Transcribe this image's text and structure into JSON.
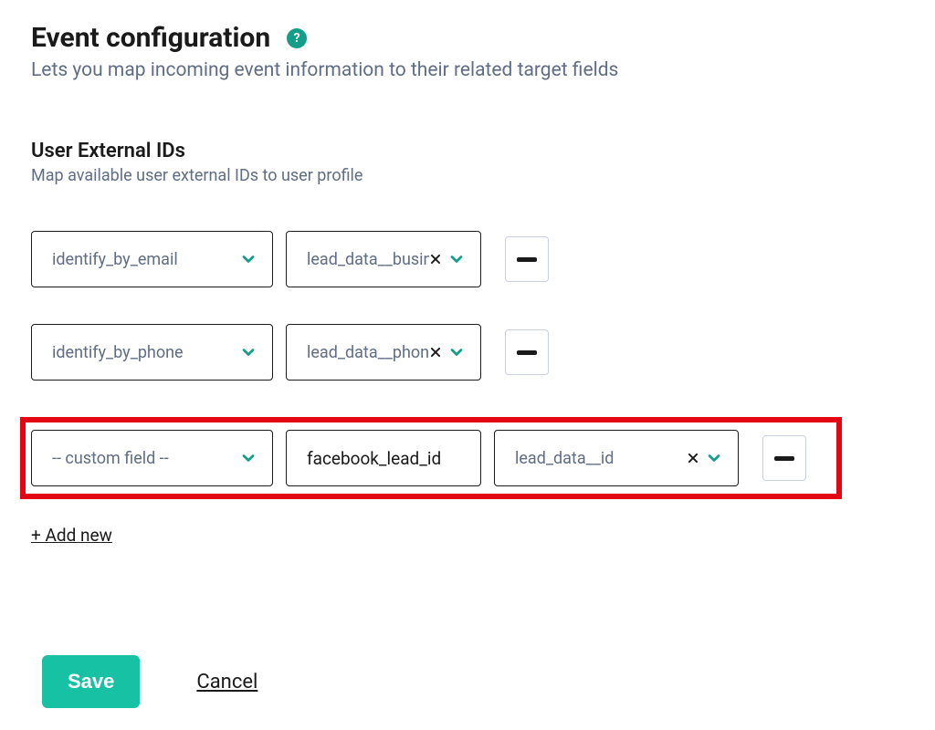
{
  "header": {
    "title": "Event configuration",
    "help_tooltip": "?",
    "subtitle": "Lets you map incoming event information to their related target fields"
  },
  "section": {
    "title": "User External IDs",
    "subtitle": "Map available user external IDs to user profile"
  },
  "rows": [
    {
      "field_select": "identify_by_email",
      "custom_name": null,
      "value_select": "lead_data__business_email",
      "highlighted": false
    },
    {
      "field_select": "identify_by_phone",
      "custom_name": null,
      "value_select": "lead_data__phone_number",
      "highlighted": false
    },
    {
      "field_select": "-- custom field --",
      "custom_name": "facebook_lead_id",
      "value_select": "lead_data__id",
      "highlighted": true
    }
  ],
  "actions": {
    "add_new": "+ Add new",
    "save": "Save",
    "cancel": "Cancel"
  }
}
